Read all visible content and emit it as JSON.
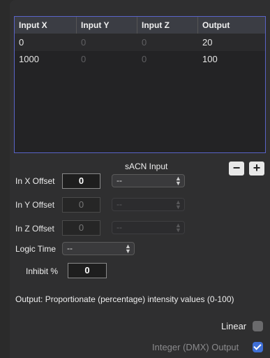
{
  "table": {
    "columns": [
      "Input X",
      "Input Y",
      "Input Z",
      "Output"
    ],
    "rows": [
      [
        "0",
        "0",
        "0",
        "20"
      ],
      [
        "1000",
        "0",
        "0",
        "100"
      ]
    ]
  },
  "sacn_header": "sACN Input",
  "controls": {
    "minus_label": "−",
    "plus_label": "+"
  },
  "offsets": {
    "x": {
      "label": "In X Offset",
      "value": "0",
      "source": "--"
    },
    "y": {
      "label": "In Y Offset",
      "value": "0",
      "source": "--"
    },
    "z": {
      "label": "In Z Offset",
      "value": "0",
      "source": "--"
    }
  },
  "logic_time": {
    "label": "Logic Time",
    "value": "--"
  },
  "inhibit": {
    "label": "Inhibit %",
    "value": "0"
  },
  "output_note": "Output: Proportionate (percentage) intensity values (0-100)",
  "linear": {
    "label": "Linear",
    "checked": false
  },
  "integer_output": {
    "label": "Integer (DMX) Output",
    "checked": true
  }
}
